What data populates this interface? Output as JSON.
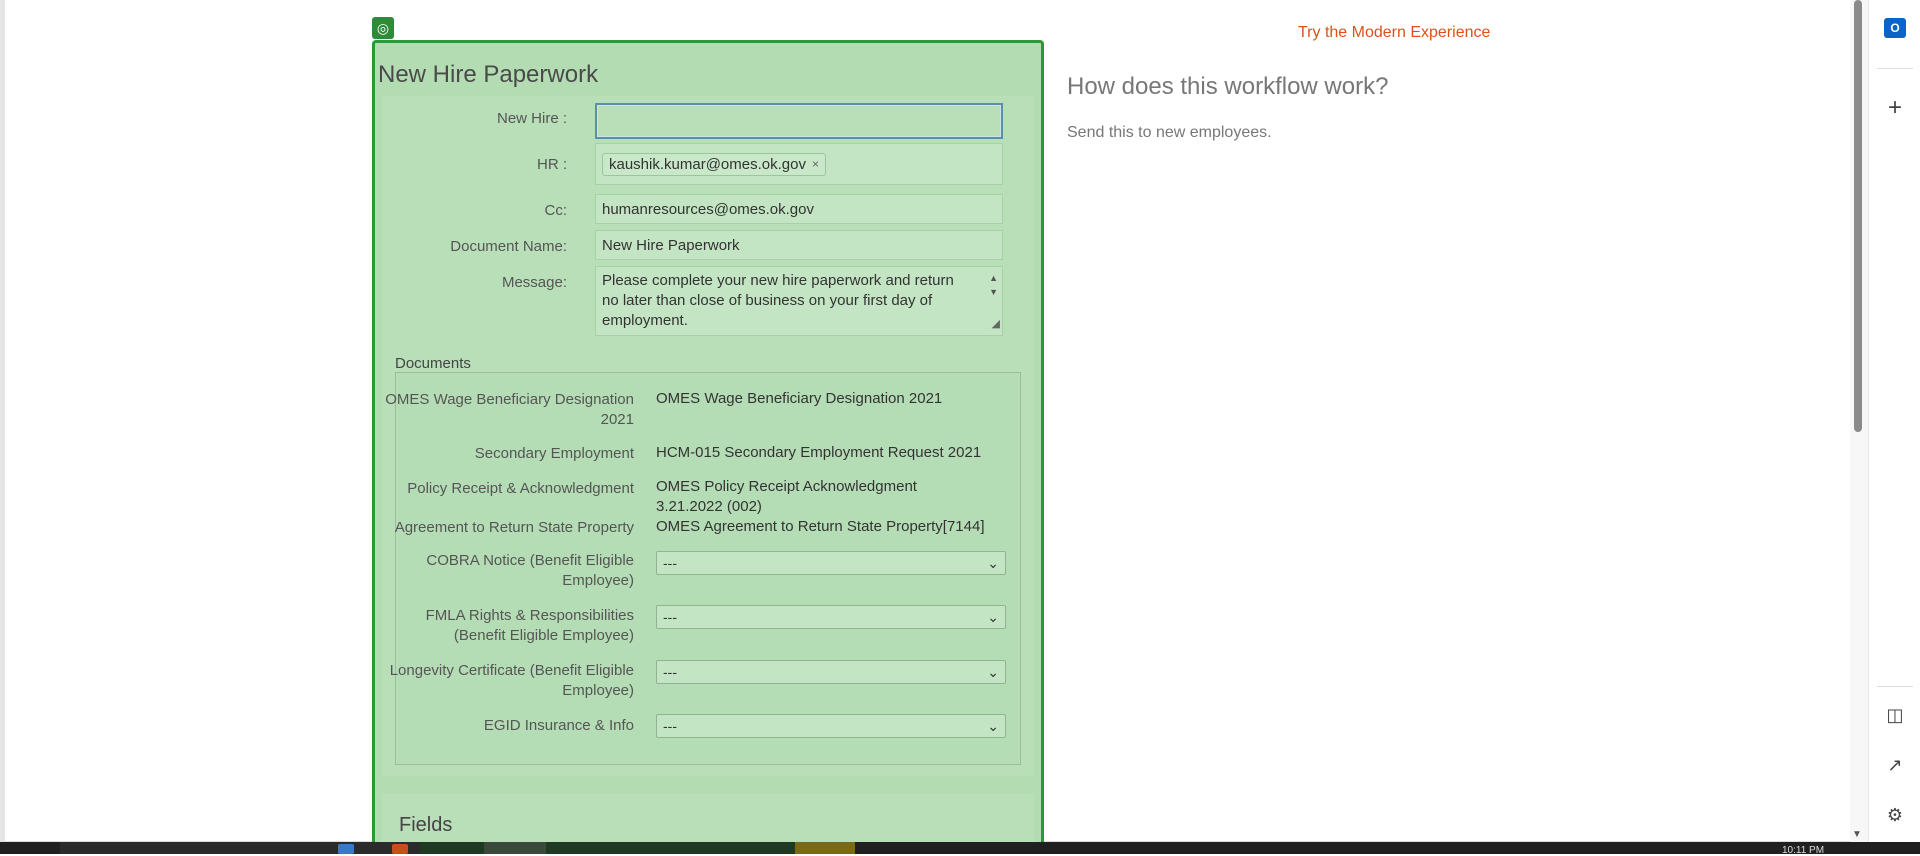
{
  "panel": {
    "badge_icon": "◎",
    "title": "New Hire Paperwork"
  },
  "form": {
    "new_hire": {
      "label": "New Hire :",
      "value": ""
    },
    "hr": {
      "label": "HR :",
      "token": "kaushik.kumar@omes.ok.gov",
      "remove_icon": "×"
    },
    "cc": {
      "label": "Cc:",
      "value": "humanresources@omes.ok.gov"
    },
    "document_name": {
      "label": "Document Name:",
      "value": "New Hire Paperwork"
    },
    "message": {
      "label": "Message:",
      "value": "Please complete your new hire paperwork and return no later than close of business on your first day of employment."
    }
  },
  "documents": {
    "label": "Documents",
    "items": [
      {
        "label": "OMES Wage Beneficiary Designation 2021",
        "value": "OMES Wage Beneficiary Designation 2021"
      },
      {
        "label": "Secondary Employment",
        "value": "HCM-015 Secondary Employment Request 2021"
      },
      {
        "label": "Policy Receipt & Acknowledgment",
        "value": "OMES Policy Receipt Acknowledgment 3.21.2022 (002)"
      },
      {
        "label": "Agreement to Return State Property",
        "value": "OMES Agreement to Return State Property[7144]"
      }
    ],
    "selects": [
      {
        "label": "COBRA Notice (Benefit Eligible Employee)",
        "value": "---"
      },
      {
        "label": "FMLA Rights & Responsibilities (Benefit Eligible Employee)",
        "value": "---"
      },
      {
        "label": "Longevity Certificate (Benefit Eligible Employee)",
        "value": "---"
      },
      {
        "label": "EGID Insurance & Info",
        "value": "---"
      }
    ]
  },
  "fields": {
    "title": "Fields"
  },
  "side": {
    "modern_link": "Try the Modern Experience",
    "info_title": "How does this workflow work?",
    "info_text": "Send this to new employees."
  },
  "rail": {
    "outlook_icon": "O",
    "add_icon": "+",
    "split_icon": "◫",
    "external_icon": "↗",
    "settings_icon": "⚙"
  },
  "taskbar": {
    "clock": "10:11 PM"
  },
  "colors": {
    "panel_bg": "#b3dcb3",
    "panel_border": "#2a9a37",
    "link": "#e0501b"
  }
}
